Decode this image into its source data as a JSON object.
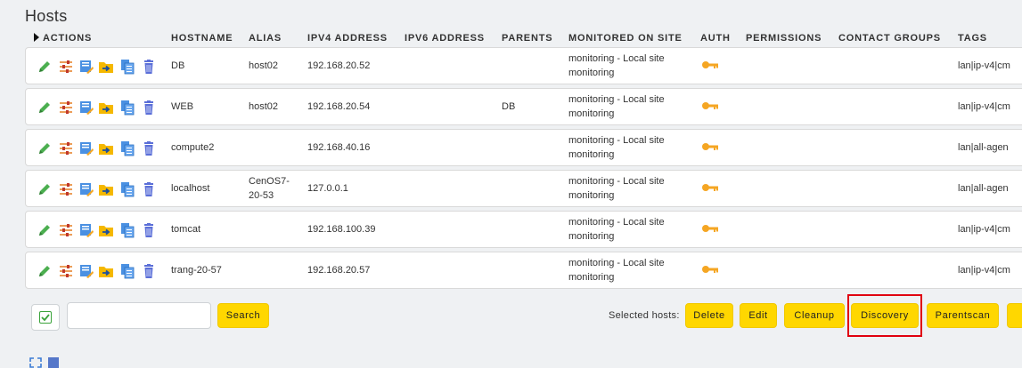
{
  "page": {
    "title": "Hosts"
  },
  "table": {
    "headers": {
      "actions": "ACTIONS",
      "hostname": "HOSTNAME",
      "alias": "ALIAS",
      "ipv4": "IPV4 ADDRESS",
      "ipv6": "IPV6 ADDRESS",
      "parents": "PARENTS",
      "site": "MONITORED ON SITE",
      "auth": "AUTH",
      "permissions": "PERMISSIONS",
      "contact_groups": "CONTACT GROUPS",
      "tags": "TAGS"
    },
    "rows": [
      {
        "hostname": "DB",
        "alias": "host02",
        "alias2": "",
        "ipv4": "192.168.20.52",
        "parents": "",
        "site1": "monitoring - Local site",
        "site2": "monitoring",
        "tags": "lan|ip-v4|cm"
      },
      {
        "hostname": "WEB",
        "alias": "host02",
        "alias2": "",
        "ipv4": "192.168.20.54",
        "parents": "DB",
        "site1": "monitoring - Local site",
        "site2": "monitoring",
        "tags": "lan|ip-v4|cm"
      },
      {
        "hostname": "compute2",
        "alias": "",
        "alias2": "",
        "ipv4": "192.168.40.16",
        "parents": "",
        "site1": "monitoring - Local site",
        "site2": "monitoring",
        "tags": "lan|all-agen"
      },
      {
        "hostname": "localhost",
        "alias": "CenOS7-",
        "alias2": "20-53",
        "ipv4": "127.0.0.1",
        "parents": "",
        "site1": "monitoring - Local site",
        "site2": "monitoring",
        "tags": "lan|all-agen"
      },
      {
        "hostname": "tomcat",
        "alias": "",
        "alias2": "",
        "ipv4": "192.168.100.39",
        "parents": "",
        "site1": "monitoring - Local site",
        "site2": "monitoring",
        "tags": "lan|ip-v4|cm"
      },
      {
        "hostname": "trang-20-57",
        "alias": "",
        "alias2": "",
        "ipv4": "192.168.20.57",
        "parents": "",
        "site1": "monitoring - Local site",
        "site2": "monitoring",
        "tags": "lan|ip-v4|cm"
      }
    ]
  },
  "footer": {
    "search_button": "Search",
    "search_placeholder": "",
    "selected_hosts_label": "Selected hosts:",
    "buttons": {
      "delete": "Delete",
      "edit": "Edit",
      "cleanup": "Cleanup",
      "discovery": "Discovery",
      "parentscan": "Parentscan"
    }
  },
  "colors": {
    "accent_button": "#ffd700",
    "highlight": "#e0000f",
    "key_icon": "#f5a623"
  },
  "icons": [
    "edit-pencil-icon",
    "parameters-icon",
    "services-icon",
    "move-folder-icon",
    "clone-icon",
    "delete-trash-icon",
    "key-icon",
    "checkbox-icon",
    "expand-icon"
  ]
}
